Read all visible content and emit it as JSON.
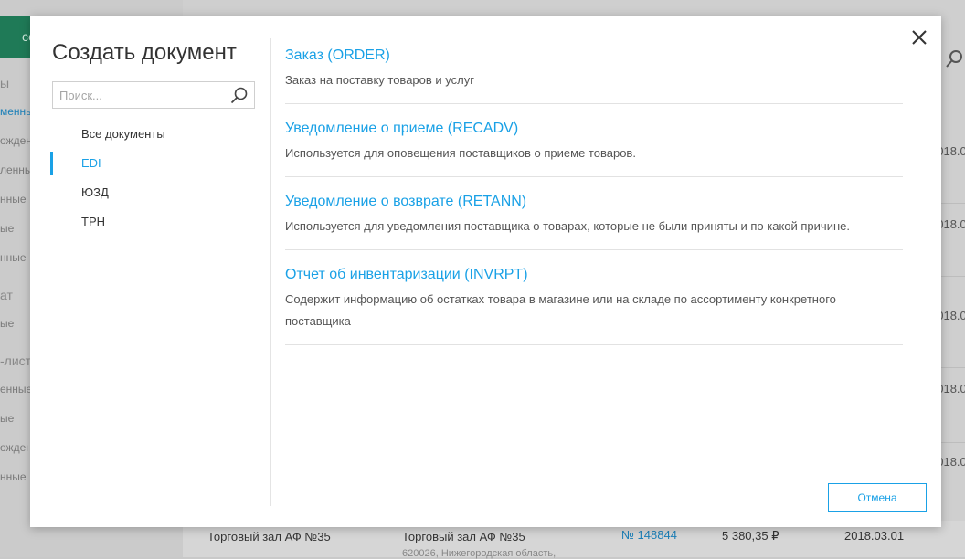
{
  "modal": {
    "title": "Создать документ",
    "search": {
      "placeholder": "Поиск...",
      "value": ""
    },
    "categories": [
      {
        "label": "Все документы",
        "active": false
      },
      {
        "label": "EDI",
        "active": true
      },
      {
        "label": "ЮЗД",
        "active": false
      },
      {
        "label": "ТРН",
        "active": false
      }
    ],
    "documents": [
      {
        "title": "Заказ (ORDER)",
        "description": "Заказ на поставку товаров и услуг"
      },
      {
        "title": "Уведомление о приеме (RECADV)",
        "description": "Используется для оповещения поставщиков о приеме товаров."
      },
      {
        "title": "Уведомление о возврате (RETANN)",
        "description": "Используется для уведомления поставщика о товарах, которые не были приняты и по какой причине."
      },
      {
        "title": "Отчет об инвентаризации (INVRPT)",
        "description": "Содержит информацию об остатках товара в магазине или на складе по ассортименту конкретного поставщика"
      }
    ],
    "cancel_label": "Отмена"
  },
  "background": {
    "green_button_label": "со",
    "sidebar": [
      {
        "label": "ы",
        "kind": "head"
      },
      {
        "label": "менные",
        "kind": "item",
        "active": true
      },
      {
        "label": "ожден",
        "kind": "item"
      },
      {
        "label": "ленные",
        "kind": "item"
      },
      {
        "label": "нные",
        "kind": "item"
      },
      {
        "label": "ые",
        "kind": "item"
      },
      {
        "label": "нные",
        "kind": "item"
      },
      {
        "label": "ат",
        "kind": "head"
      },
      {
        "label": "ые",
        "kind": "item"
      },
      {
        "label": "-лист",
        "kind": "head"
      },
      {
        "label": "енные",
        "kind": "item"
      },
      {
        "label": "ые",
        "kind": "item"
      },
      {
        "label": "ожден",
        "kind": "item"
      },
      {
        "label": "нные",
        "kind": "item"
      }
    ],
    "dates": [
      "2018.0",
      "2018.0",
      "2018.0",
      "2018.0",
      "2018.0"
    ],
    "bottom_row": {
      "store": "Торговый зал АФ №35",
      "store2": "Торговый зал АФ №35",
      "address": "620026, Нижегородская область,",
      "number": "№ 148844",
      "amount": "5 380,35 ₽",
      "date": "2018.03.01"
    }
  },
  "colors": {
    "accent": "#1aa1e6",
    "brand_green": "#1f7a57"
  }
}
